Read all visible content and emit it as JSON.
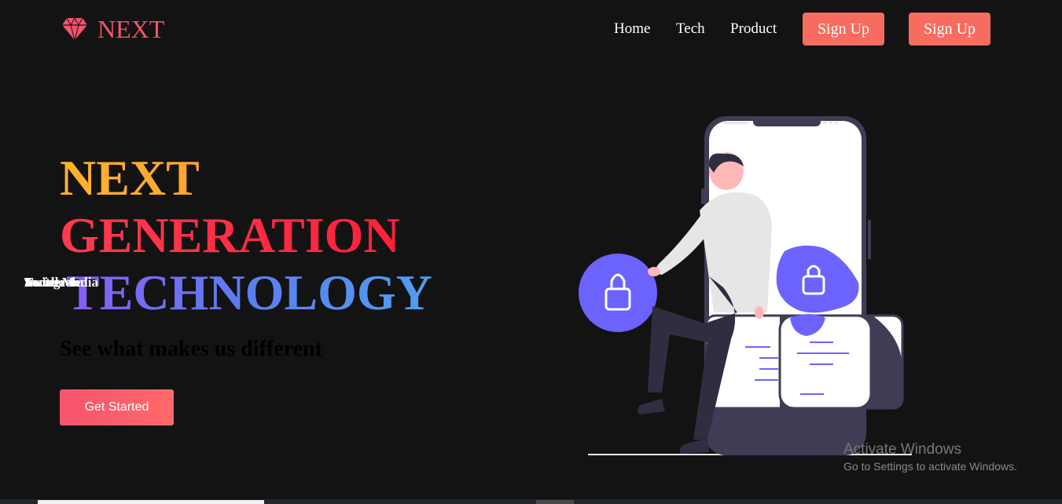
{
  "brand": {
    "name": "NEXT",
    "icon": "diamond-icon",
    "color": "#f5536d"
  },
  "nav": {
    "links": [
      "Home",
      "Tech",
      "Product"
    ],
    "signup_1": "Sign Up",
    "signup_2": "Sign Up",
    "button_color": "#f76c5e"
  },
  "hero": {
    "title_line1": "NEXT",
    "title_line2": "GENERATION",
    "title_line3": "TECHNOLOGY",
    "overlap_text": [
      "Twitter",
      "Facebook",
      "Instagram",
      "Social Media"
    ],
    "subtitle": "See what makes us different",
    "cta": "Get Started"
  },
  "illustration": {
    "name": "security-phone-illustration",
    "accent": "#6c63ff"
  },
  "watermark": {
    "line1": "Activate Windows",
    "line2": "Go to Settings to activate Windows."
  }
}
